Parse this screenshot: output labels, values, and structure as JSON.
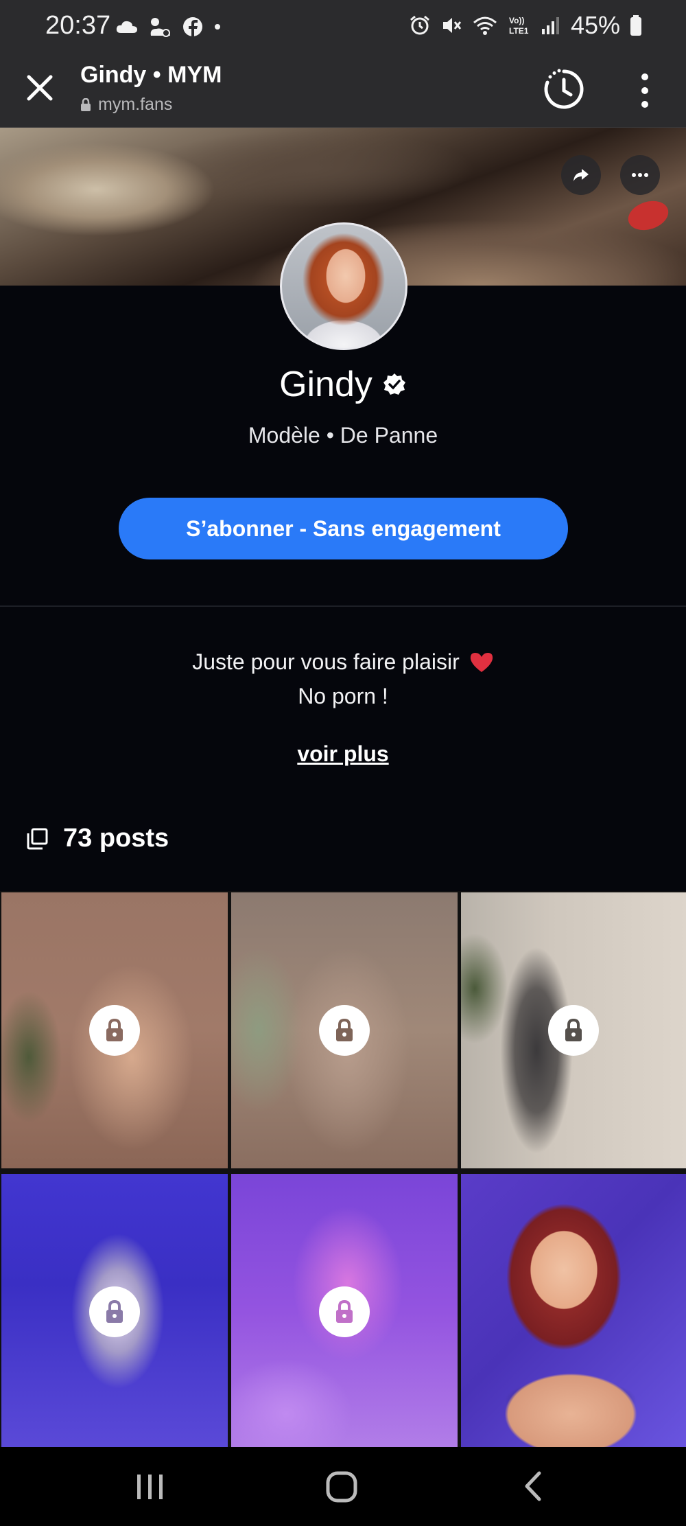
{
  "status_bar": {
    "time": "20:37",
    "battery": "45%",
    "left_icons": [
      "cloud-icon",
      "weather-icon",
      "facebook-icon",
      "dot-icon"
    ],
    "right_icons": [
      "alarm-icon",
      "mute-icon",
      "wifi-icon",
      "volte-icon",
      "signal-icon",
      "battery-icon"
    ],
    "volte_label": "Vo))\nLTE1"
  },
  "browser": {
    "title": "Gindy • MYM",
    "url": "mym.fans"
  },
  "profile": {
    "name": "Gindy",
    "subtitle": "Modèle • De Panne",
    "subscribe_label": "S’abonner - Sans engagement",
    "bio_line1": "Juste pour vous faire plaisir",
    "bio_line2": "No porn !",
    "see_more": "voir plus",
    "posts_count": "73 posts"
  },
  "posts": [
    {
      "locked": true
    },
    {
      "locked": true
    },
    {
      "locked": true
    },
    {
      "locked": true
    },
    {
      "locked": true
    },
    {
      "locked": false
    }
  ],
  "colors": {
    "accent": "#2a7af8",
    "background": "#05060c",
    "bars": "#2b2b2d",
    "heart": "#e03040"
  }
}
